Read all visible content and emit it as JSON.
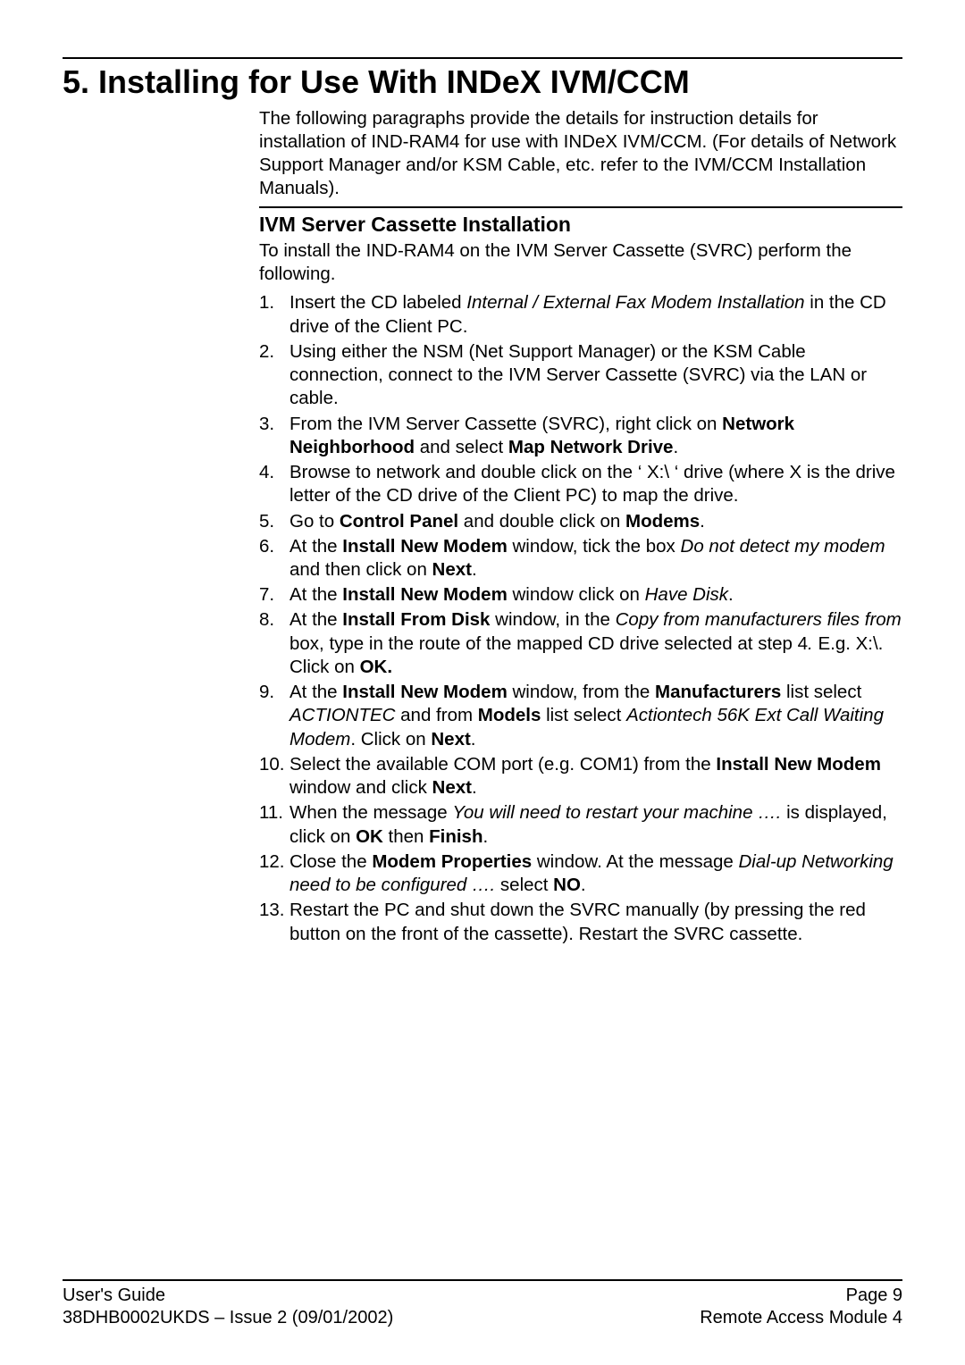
{
  "title": "5. Installing for Use With INDeX IVM/CCM",
  "intro": "The following paragraphs provide the details for instruction details for installation of IND-RAM4 for use with INDeX IVM/CCM. (For details of Network Support Manager and/or KSM Cable, etc. refer to the IVM/CCM Installation Manuals).",
  "subheading": "IVM Server Cassette Installation",
  "lead": "To install the IND-RAM4 on the IVM Server Cassette (SVRC) perform the following.",
  "steps": [
    {
      "n": "1.",
      "html": "Insert the CD labeled <i>Internal / External Fax Modem Installation</i> in the CD drive of the Client PC."
    },
    {
      "n": "2.",
      "html": "Using either the NSM (Net Support Manager) or the KSM Cable connection, connect to the IVM Server Cassette (SVRC) via the LAN or cable."
    },
    {
      "n": "3.",
      "html": "From the IVM Server Cassette (SVRC), right click on <b>Network Neighborhood</b> and select <b>Map Network Drive</b>."
    },
    {
      "n": "4.",
      "html": "Browse to network and double click on the &lsquo; X:\\ &lsquo; drive (where X is the drive letter of the CD drive of the Client PC) to map the drive."
    },
    {
      "n": "5.",
      "html": "Go to <b>Control Panel</b> and double click on <b>Modems</b>."
    },
    {
      "n": "6.",
      "html": "At the <b>Install New Modem</b> window, tick the box <i>Do not detect my modem</i> and then click on <b>Next</b>."
    },
    {
      "n": "7.",
      "html": "At the <b>Install New Modem</b> window click on <i>Have Disk</i>."
    },
    {
      "n": "8.",
      "html": "At the <b>Install From Disk</b> window, in the <i>Copy from manufacturers files from</i> box, type in the route of the mapped CD drive selected at step 4<i>.</i> E.g. X:\\. Click on <b>OK.</b>"
    },
    {
      "n": "9.",
      "html": "At the <b>Install New Modem</b> window, from the <b>Manufacturers</b> list select <i>ACTIONTEC</i> and from <b>Models</b> list select <i>Actiontech 56K Ext Call Waiting Modem</i>. Click on <b>Next</b>."
    },
    {
      "n": "10.",
      "html": "Select the available COM port (e.g. COM1) from the <b>Install New Modem</b> window and click <b>Next</b>."
    },
    {
      "n": "11.",
      "html": "When the message <i>You will need to restart your machine &hellip;.</i> is displayed, click on <b>OK</b> then <b>Finish</b>."
    },
    {
      "n": "12.",
      "html": "Close the <b>Modem Properties</b> window. At the message <i>Dial-up Networking need to be configured &hellip;.</i> select <b>NO</b>."
    },
    {
      "n": "13.",
      "html": "Restart the PC and shut down the SVRC manually (by pressing the red button on the front of the cassette). Restart the SVRC cassette."
    }
  ],
  "footer": {
    "left1": "User's Guide",
    "left2": "38DHB0002UKDS – Issue 2 (09/01/2002)",
    "right1": "Page 9",
    "right2": "Remote Access Module 4"
  }
}
